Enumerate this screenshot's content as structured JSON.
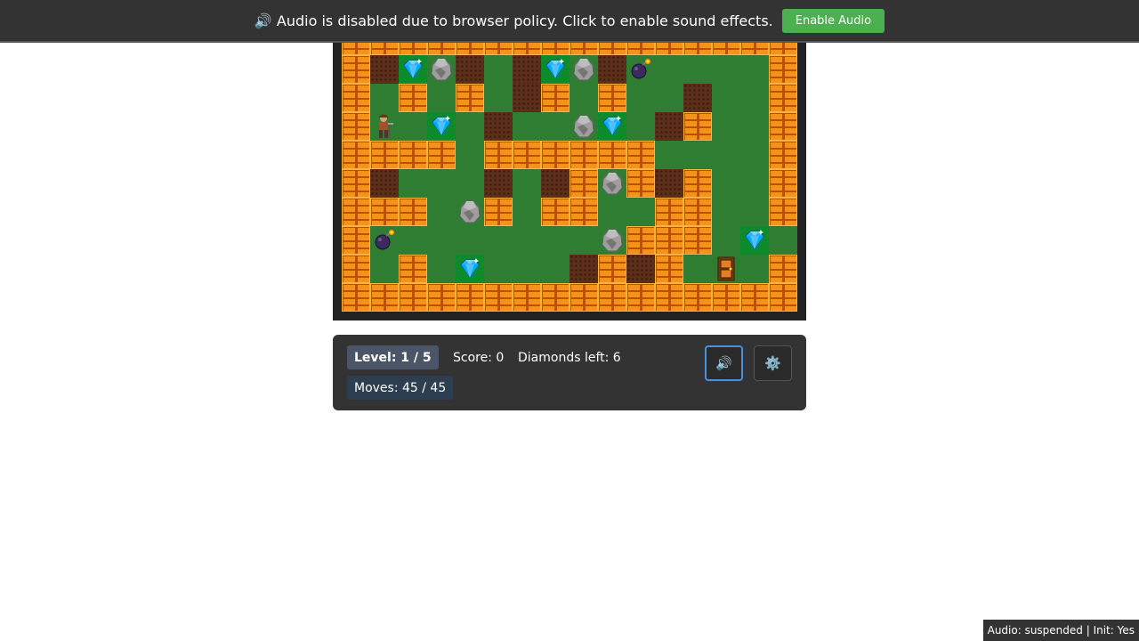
{
  "audio_banner": {
    "message": "🔊 Audio is disabled due to browser policy. Click to enable sound effects.",
    "button_label": "Enable Audio"
  },
  "hud": {
    "level": "Level: 1 / 5",
    "score": "Score: 0",
    "diamonds_left": "Diamonds left: 6",
    "moves": "Moves: 45 / 45",
    "sound_button": "🔊",
    "settings_button": "⚙️"
  },
  "debug_status": "Audio: suspended | Init: Yes",
  "legend": {
    "B": "brick-wall",
    ".": "grass",
    "D": "dirt",
    "G": "diamond",
    "R": "rock",
    "M": "bomb",
    "P": "player",
    "E": "exit-door"
  },
  "board_rows": [
    "BBBBBBBBBBBBBBBB",
    "BDGRD.DGRDM....B",
    "B.B.B.DB.B..D..B",
    "BP.G.D..RG.DB..B",
    "BBBB.BBBBBB....B",
    "BD...D.DBRBDB..B",
    "BBB.RB.BB..BB..B",
    "BM.......RBBB.G.B",
    "B.B.G...DBDB.E.B",
    "BBBBBBBBBBBBBBBB"
  ]
}
